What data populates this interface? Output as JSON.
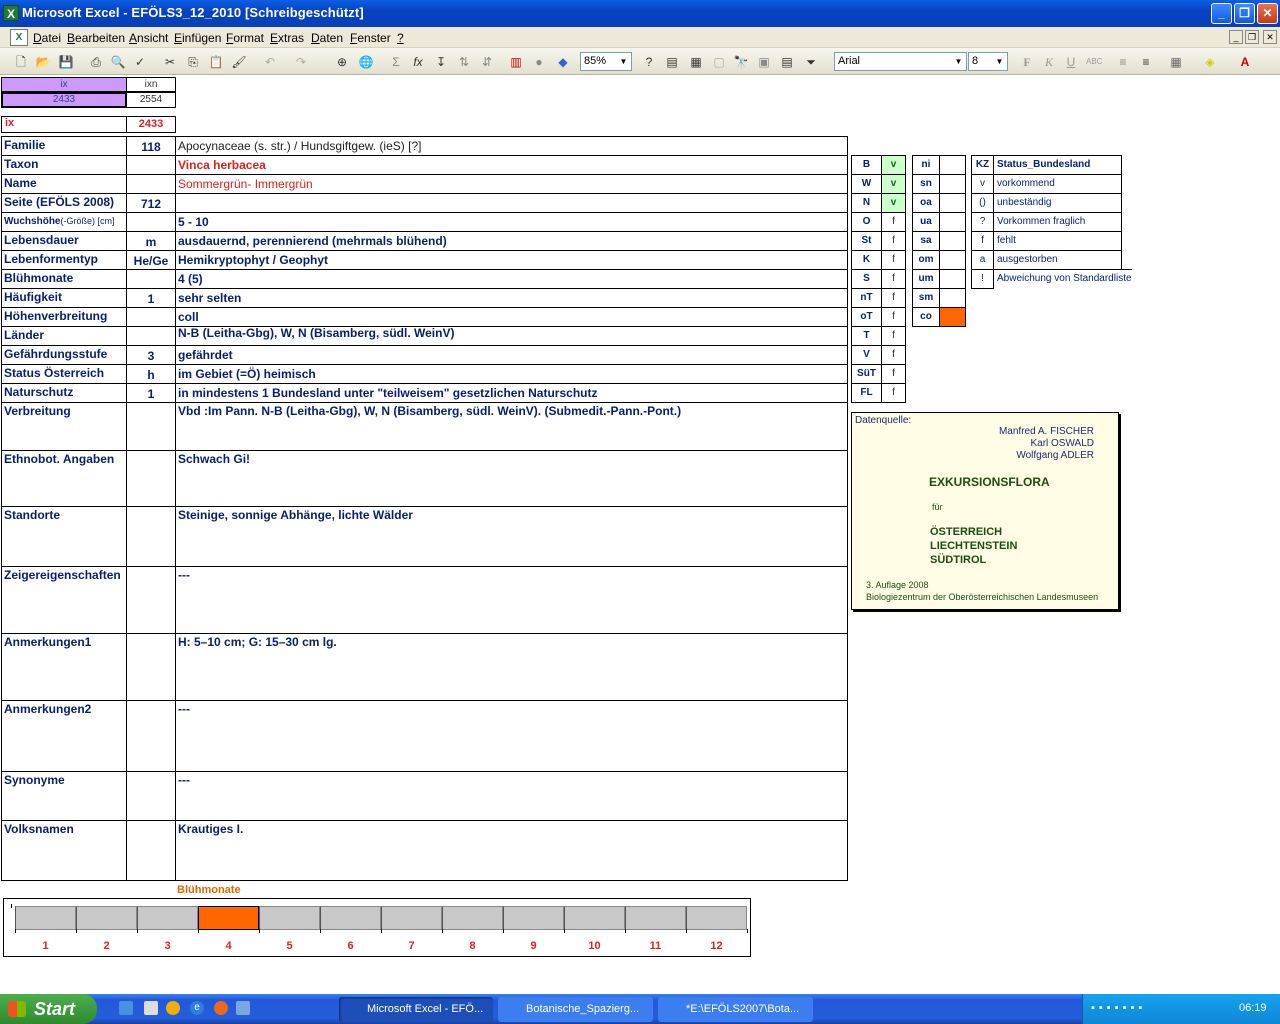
{
  "window": {
    "title": "Microsoft Excel - EFÖLS3_12_2010  [Schreibgeschützt]"
  },
  "menu": [
    "Datei",
    "Bearbeiten",
    "Ansicht",
    "Einfügen",
    "Format",
    "Extras",
    "Daten",
    "Fenster",
    "?"
  ],
  "toolbar": {
    "zoom": "85%",
    "font": "Arial",
    "size": "8"
  },
  "sheet": {
    "ix_head": "ix",
    "ixn_head": "ixn",
    "ix_val": "2433",
    "ixn_val": "2554",
    "ix_label": "ix",
    "ix_red": "2433",
    "rows": [
      {
        "label": "Familie",
        "code": "118",
        "value": "Apocynaceae (s. str.)  /  Hundsgiftgew. (ieS) [?]"
      },
      {
        "label": "Taxon",
        "code": "",
        "value": "Vinca herbacea"
      },
      {
        "label": "Name",
        "code": "",
        "value": "Sommergrün- Immergrün"
      },
      {
        "label": "Seite (EFÖLS 2008)",
        "code": "712",
        "value": ""
      },
      {
        "label": "Wuchshöhe",
        "label_small": "(-Größe) [cm]",
        "code": "",
        "value": " 5 - 10"
      },
      {
        "label": "Lebensdauer",
        "code": "m",
        "value": "ausdauernd, perennierend (mehrmals blühend)"
      },
      {
        "label": "Lebenformentyp",
        "code": "He/Ge",
        "value": "Hemikryptophyt / Geophyt"
      },
      {
        "label": "Blühmonate",
        "code": "",
        "value": " 4 (5)"
      },
      {
        "label": "Häufigkeit",
        "code": "1",
        "value": "sehr selten"
      },
      {
        "label": "Höhenverbreitung",
        "code": "",
        "value": "coll"
      },
      {
        "label": "Länder",
        "code": "",
        "value": "N-B (Leitha-Gbg), W, N (Bisamberg, südl. WeinV)"
      },
      {
        "label": "Gefährdungsstufe",
        "code": "3",
        "value": "gefährdet"
      },
      {
        "label": "Status Österreich",
        "code": "h",
        "value": "im Gebiet (=Ö) heimisch"
      },
      {
        "label": "Naturschutz",
        "code": "1",
        "value": "in mindestens 1 Bundesland unter \"teilweisem\" gesetzlichen Naturschutz"
      }
    ],
    "big_rows": [
      {
        "label": "Verbreitung",
        "value": "Vbd :Im Pann. N-B (Leitha-Gbg), W, N (Bisamberg, südl. WeinV). (Submedit.-Pann.-Pont.)"
      },
      {
        "label": "Ethnobot. Angaben",
        "value": "Schwach Gi!"
      },
      {
        "label": "Standorte",
        "value": "Steinige, sonnige Abhänge, lichte Wälder"
      },
      {
        "label": "Zeigereigenschaften",
        "value": "---"
      },
      {
        "label": "Anmerkungen1",
        "value": "H: 5–10 cm; G: 15–30 cm lg."
      },
      {
        "label": "Anmerkungen2",
        "value": "---"
      },
      {
        "label": "Synonyme",
        "value": "---"
      },
      {
        "label": "Volksnamen",
        "value": "Krautiges I."
      }
    ],
    "states": [
      {
        "code": "B",
        "v": "v"
      },
      {
        "code": "W",
        "v": "v"
      },
      {
        "code": "N",
        "v": "v"
      },
      {
        "code": "O",
        "v": "f"
      },
      {
        "code": "St",
        "v": "f"
      },
      {
        "code": "K",
        "v": "f"
      },
      {
        "code": "S",
        "v": "f"
      },
      {
        "code": "nT",
        "v": "f"
      },
      {
        "code": "oT",
        "v": "f"
      },
      {
        "code": "T",
        "v": "f"
      },
      {
        "code": "V",
        "v": "f"
      },
      {
        "code": "SüT",
        "v": "f"
      },
      {
        "code": "FL",
        "v": "f"
      }
    ],
    "alt_levels": [
      "ni",
      "sn",
      "oa",
      "ua",
      "sa",
      "om",
      "um",
      "sm",
      "co"
    ],
    "legend_head": {
      "kz": "KZ",
      "title": "Status_Bundesland"
    },
    "legend": [
      {
        "kz": "v",
        "text": "vorkommend"
      },
      {
        "kz": "()",
        "text": "unbeständig"
      },
      {
        "kz": "?",
        "text": "Vorkommen fraglich"
      },
      {
        "kz": "f",
        "text": "fehlt"
      },
      {
        "kz": "a",
        "text": "ausgestorben"
      },
      {
        "kz": "!",
        "text": "Abweichung von Standardliste(?)"
      }
    ],
    "source": {
      "label": "Datenquelle:",
      "a1": "Manfred A. FISCHER",
      "a2": "Karl OSWALD",
      "a3": "Wolfgang ADLER",
      "t1": "EXKURSIONSFLORA",
      "t2": "für",
      "t3": "ÖSTERREICH",
      "t4": "LIECHTENSTEIN",
      "t5": "SÜDTIROL",
      "ed": "3. Auflage 2008",
      "pub": "Biologiezentrum der Oberösterreichischen Landesmuseen"
    },
    "bloom_title": "Blühmonate",
    "months": [
      "1",
      "2",
      "3",
      "4",
      "5",
      "6",
      "7",
      "8",
      "9",
      "10",
      "11",
      "12"
    ],
    "bloom_active": [
      4
    ],
    "colors": {
      "accent": "#ff6600",
      "v_green": "#ccffcc",
      "purple": "#cc99ff"
    }
  },
  "taskbar": {
    "start": "Start",
    "tasks": [
      "Microsoft Excel - EFÖ...",
      "Botanische_Spazierg...",
      "*E:\\EFÖLS2007\\Bota..."
    ],
    "clock": "06:19"
  }
}
